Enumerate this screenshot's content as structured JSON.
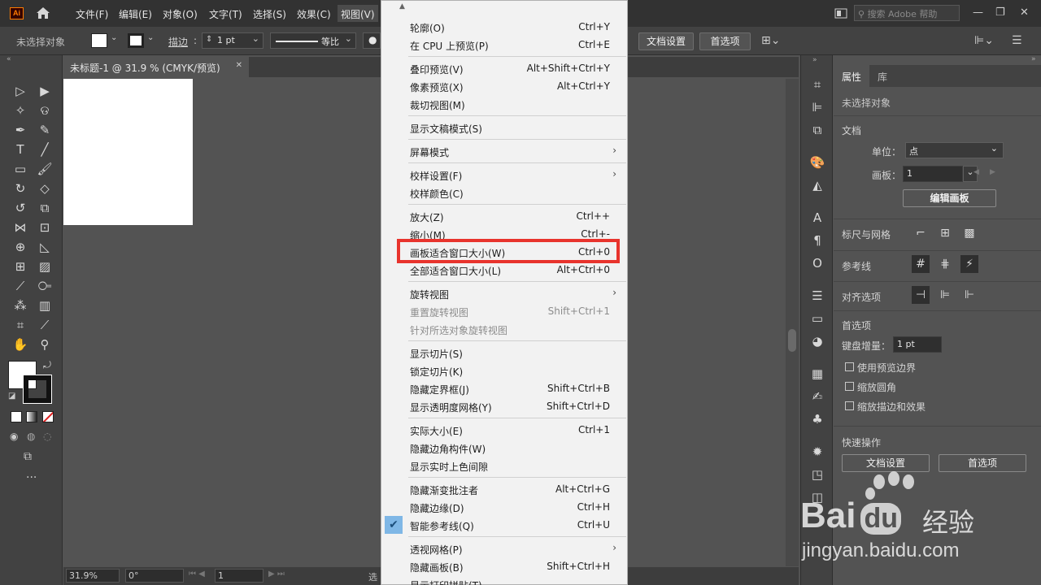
{
  "menubar": {
    "logo": "Ai",
    "items": [
      "文件(F)",
      "编辑(E)",
      "对象(O)",
      "文字(T)",
      "选择(S)",
      "效果(C)",
      "视图(V)"
    ],
    "search_placeholder": "搜索 Adobe 帮助",
    "window_controls": [
      "—",
      "❐",
      "✕"
    ]
  },
  "controlbar": {
    "selection_label": "未选择对象",
    "stroke_label": "描边",
    "stroke_value": "1 pt",
    "profile_label": "等比",
    "doc_setup_btn": "文档设置",
    "prefs_btn": "首选项"
  },
  "document": {
    "tab_title": "未标题-1 @ 31.9 % (CMYK/预览)",
    "tab_close": "✕"
  },
  "statusbar": {
    "zoom": "31.9%",
    "rotation": "0°",
    "artboard_num": "1",
    "tool_hint": "选"
  },
  "view_menu": {
    "items": [
      {
        "label": "轮廓(O)",
        "shortcut": "Ctrl+Y"
      },
      {
        "label": "在 CPU 上预览(P)",
        "shortcut": "Ctrl+E"
      },
      {
        "label": "叠印预览(V)",
        "shortcut": "Alt+Shift+Ctrl+Y"
      },
      {
        "label": "像素预览(X)",
        "shortcut": "Alt+Ctrl+Y"
      },
      {
        "label": "裁切视图(M)",
        "shortcut": ""
      },
      {
        "label": "显示文稿模式(S)",
        "shortcut": ""
      },
      {
        "label": "屏幕模式",
        "shortcut": ""
      },
      {
        "label": "校样设置(F)",
        "shortcut": ""
      },
      {
        "label": "校样颜色(C)",
        "shortcut": ""
      },
      {
        "label": "放大(Z)",
        "shortcut": "Ctrl++"
      },
      {
        "label": "缩小(M)",
        "shortcut": "Ctrl+-"
      },
      {
        "label": "画板适合窗口大小(W)",
        "shortcut": "Ctrl+0"
      },
      {
        "label": "全部适合窗口大小(L)",
        "shortcut": "Alt+Ctrl+0"
      },
      {
        "label": "旋转视图",
        "shortcut": ""
      },
      {
        "label": "重置旋转视图",
        "shortcut": "Shift+Ctrl+1"
      },
      {
        "label": "针对所选对象旋转视图",
        "shortcut": ""
      },
      {
        "label": "显示切片(S)",
        "shortcut": ""
      },
      {
        "label": "锁定切片(K)",
        "shortcut": ""
      },
      {
        "label": "隐藏定界框(J)",
        "shortcut": "Shift+Ctrl+B"
      },
      {
        "label": "显示透明度网格(Y)",
        "shortcut": "Shift+Ctrl+D"
      },
      {
        "label": "实际大小(E)",
        "shortcut": "Ctrl+1"
      },
      {
        "label": "隐藏边角构件(W)",
        "shortcut": ""
      },
      {
        "label": "显示实时上色间隙",
        "shortcut": ""
      },
      {
        "label": "隐藏渐变批注者",
        "shortcut": "Alt+Ctrl+G"
      },
      {
        "label": "隐藏边缘(D)",
        "shortcut": "Ctrl+H"
      },
      {
        "label": "智能参考线(Q)",
        "shortcut": "Ctrl+U"
      },
      {
        "label": "透视网格(P)",
        "shortcut": ""
      },
      {
        "label": "隐藏画板(B)",
        "shortcut": "Shift+Ctrl+H"
      },
      {
        "label": "显示打印拼贴(T)",
        "shortcut": ""
      }
    ]
  },
  "properties": {
    "tabs": [
      "属性",
      "库"
    ],
    "no_selection": "未选择对象",
    "document_section": "文档",
    "unit_label": "单位：",
    "unit_value": "点",
    "artboard_label": "画板：",
    "artboard_value": "1",
    "edit_artboards_btn": "编辑画板",
    "rulers_grids": "标尺与网格",
    "guides": "参考线",
    "align_options": "对齐选项",
    "preferences": "首选项",
    "keyboard_increment_label": "键盘增量：",
    "keyboard_increment_value": "1 pt",
    "use_preview_bounds": "使用预览边界",
    "scale_corners": "缩放圆角",
    "scale_strokes": "缩放描边和效果",
    "quick_actions": "快速操作",
    "doc_setup_btn": "文档设置",
    "prefs_btn": "首选项"
  },
  "watermark": {
    "brand": "Bai",
    "brand2": "du",
    "cn": "经验",
    "url": "jingyan.baidu.com"
  },
  "colors": {
    "highlight_box": "#e8342d",
    "menu_bg": "#f2f2f2",
    "ui_dark": "#323232"
  }
}
